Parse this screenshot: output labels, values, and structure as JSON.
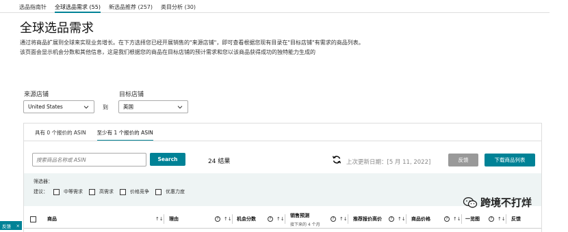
{
  "topnav": {
    "tabs": [
      {
        "label": "选品指南针"
      },
      {
        "label": "全球选品需求 (55)"
      },
      {
        "label": "新选品推荐 (257)"
      },
      {
        "label": "类目分析 (30)"
      }
    ],
    "active_index": 1
  },
  "page": {
    "title": "全球选品需求",
    "description": "通过将商品扩展到全球来实现业务增长。在下方选择您已经开展销售的\"来源店铺\"，即可查看根据您现有目录在\"目标店铺\"有需求的商品列表。该页面会显示机会分数和其他信息，这是我们根据您的商品在目标店铺的预计需求和您以该商品获得成功的独特能力生成的"
  },
  "stores": {
    "source_label": "来源店铺",
    "source_value": "United States",
    "to_label": "到",
    "target_label": "目标店铺",
    "target_value": "英国"
  },
  "subtabs": [
    {
      "label": "具有 0 个报价的 ASIN"
    },
    {
      "label": "至少有 1 个报价的 ASIN"
    }
  ],
  "toolbar": {
    "search_placeholder": "搜索商品名称或 ASIN",
    "search_label": "Search",
    "results": "24 结果",
    "last_updated": "上次更新日期：[5 月 11, 2022]",
    "feedback_label": "反馈",
    "download_label": "下载商品列表"
  },
  "filters": {
    "title": "筛选器：",
    "suggest_label": "建议：",
    "options": [
      {
        "label": "中等需求"
      },
      {
        "label": "高需求"
      },
      {
        "label": "价格竞争"
      },
      {
        "label": "优惠力度"
      }
    ]
  },
  "table": {
    "headers": {
      "product": "商品",
      "reason": "理由",
      "opportunity": "机会分数",
      "sales_forecast": "销售预测",
      "sales_forecast_sub": "接下来的 4 个月",
      "recommended_price": "推荐报价高价",
      "product_price": "商品价格",
      "overview": "一览图",
      "feedback": "反馈"
    },
    "sort_glyph": "↑↓",
    "help_glyph": "?"
  },
  "side_feedback": {
    "label": "反馈",
    "close": "×"
  },
  "watermark": {
    "text": "跨境不打烊"
  },
  "colors": {
    "accent": "#008296",
    "disabled": "#999999",
    "filter_bg": "#eef4f4"
  }
}
